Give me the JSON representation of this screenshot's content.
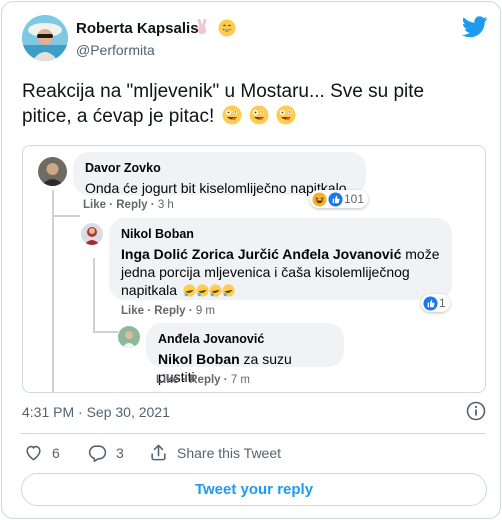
{
  "tweet": {
    "author_name": "Roberta Kapsalis",
    "author_handle": "@Performita",
    "text": "Reakcija na \"mljevenik\" u Mostaru... Sve su pite pitice, a ćevap je pitac!",
    "timestamp": "4:31 PM · Sep 30, 2021"
  },
  "facebook_thread": {
    "comments": [
      {
        "author": "Davor Zovko",
        "text": "Onda će jogurt bit kiselomliječno napitkalo",
        "actions": {
          "like": "Like",
          "reply": "Reply",
          "time": "3 h"
        },
        "reaction_count": "101"
      },
      {
        "author": "Nikol Boban",
        "mentions": "Inga Dolić Zorica Jurčić Anđela Jovanović",
        "text_line1_rest": " može",
        "text_line2": "jedna porcija mljevenica i čaša kisolemliječnog",
        "text_line3": "napitkala",
        "actions": {
          "like": "Like",
          "reply": "Reply",
          "time": "9 m"
        },
        "reaction_count": "1"
      },
      {
        "author": "Anđela Jovanović",
        "mention": "Nikol Boban",
        "text_rest": " za suzu pustiti",
        "actions": {
          "like": "Like",
          "reply": "Reply",
          "time": "7 m"
        }
      }
    ]
  },
  "stats": {
    "likes": "6",
    "replies": "3",
    "share_label": "Share this Tweet"
  },
  "reply_button_label": "Tweet your reply",
  "colors": {
    "accent": "#1d9bf0",
    "text": "#0f1419",
    "muted": "#536471",
    "border": "#cfd9de",
    "fb_bubble": "#f0f2f5"
  }
}
